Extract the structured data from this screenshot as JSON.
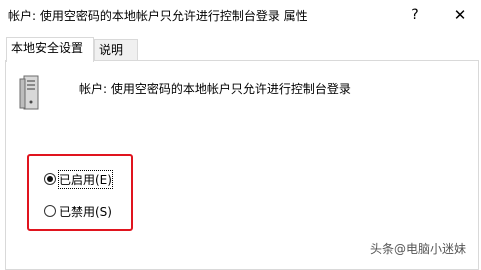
{
  "window": {
    "title": "帐户: 使用空密码的本地帐户只允许进行控制台登录 属性",
    "help_glyph": "?",
    "close_glyph": "✕"
  },
  "tabs": [
    {
      "label": "本地安全设置",
      "active": true
    },
    {
      "label": "说明",
      "active": false
    }
  ],
  "policy": {
    "name": "帐户: 使用空密码的本地帐户只允许进行控制台登录",
    "icon": "server-icon"
  },
  "options": [
    {
      "label": "已启用(E)",
      "selected": true
    },
    {
      "label": "已禁用(S)",
      "selected": false
    }
  ],
  "watermark": "头条@电脑小迷妹",
  "colors": {
    "highlight_border": "#e0141e"
  }
}
